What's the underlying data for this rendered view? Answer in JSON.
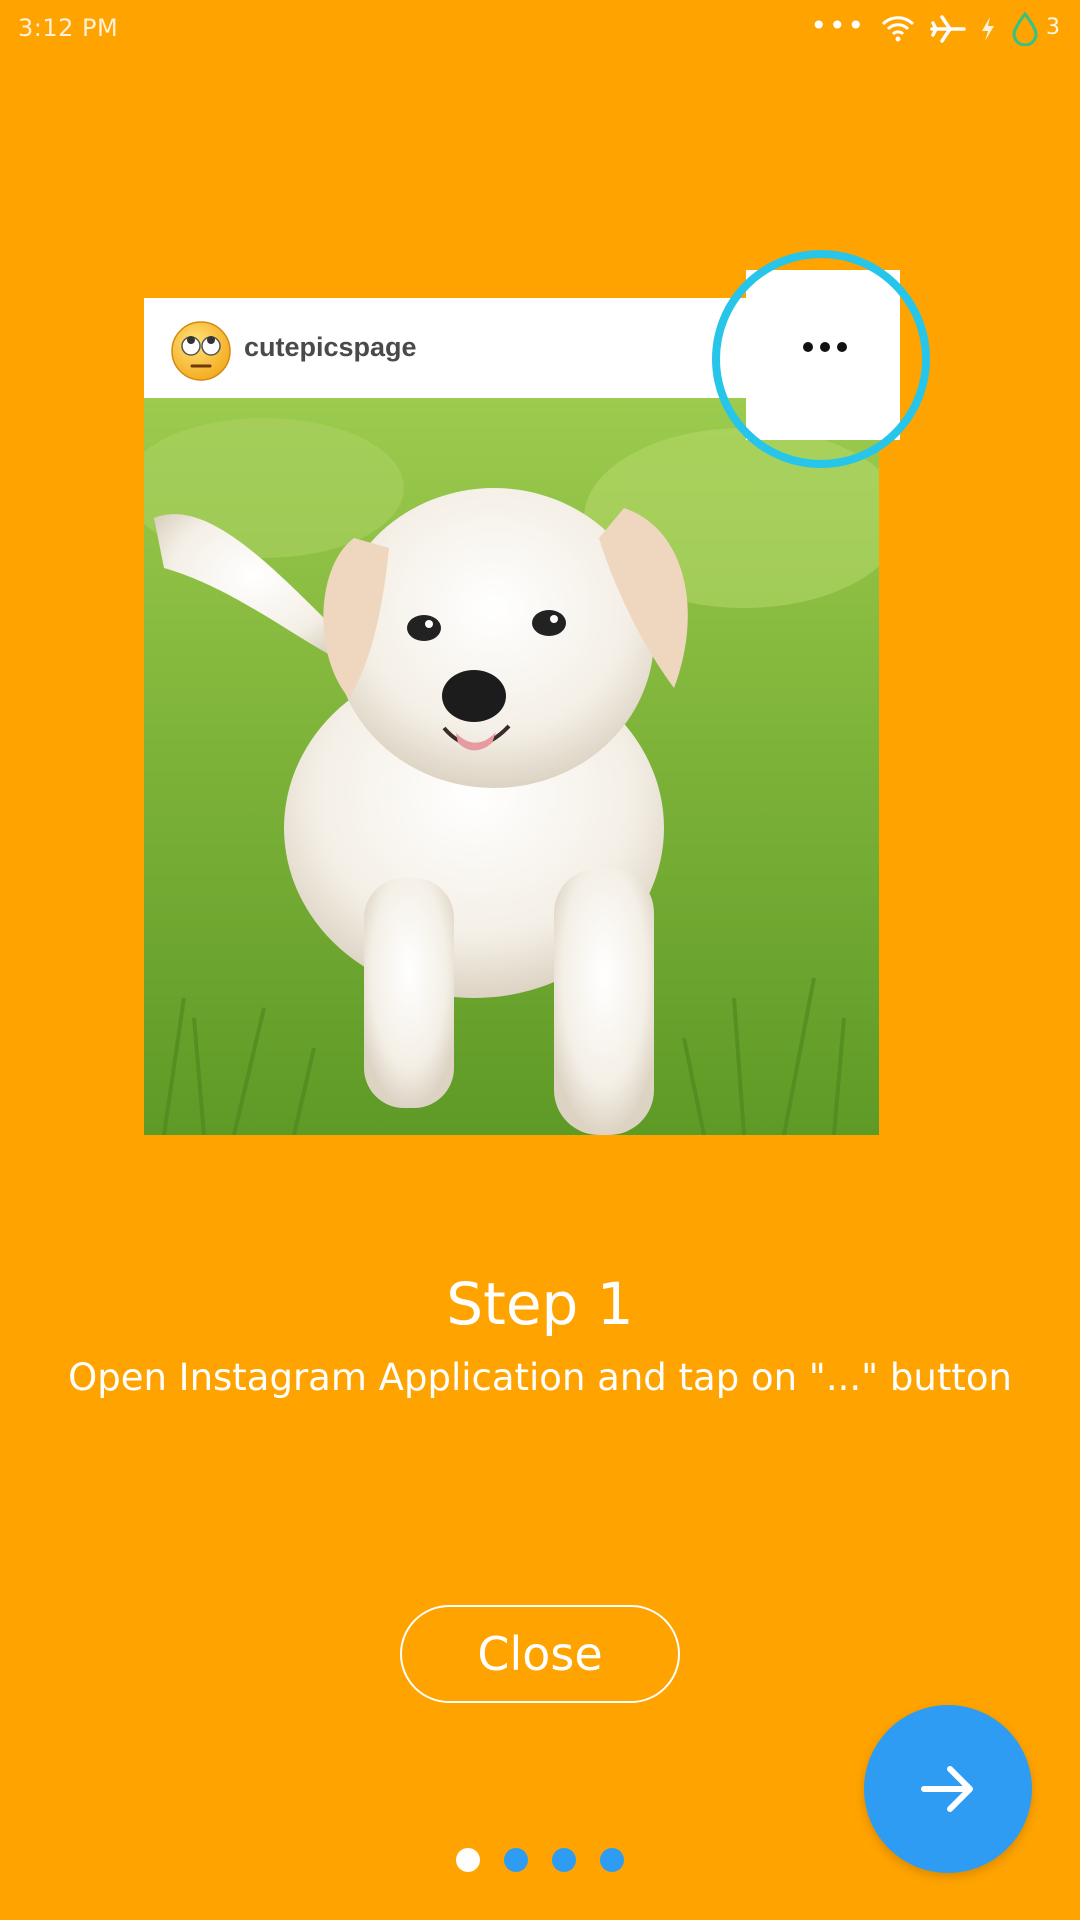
{
  "status_bar": {
    "time": "3:12 PM",
    "icons": [
      "more-dots-icon",
      "wifi-icon",
      "airplane-mode-icon",
      "charging-bolt-icon",
      "battery-drop-icon"
    ],
    "battery_level": "3"
  },
  "tutorial": {
    "post": {
      "username": "cutepicspage",
      "avatar": "eye-roll-emoji",
      "photo": "white puppy running on grass",
      "more_button": "more-options-icon"
    },
    "highlight_color": "#27C5EA",
    "step_title": "Step 1",
    "step_description": "Open Instagram Application and tap on \"...\" button",
    "close_label": "Close",
    "next_button": "arrow-right-icon",
    "pager": {
      "total": 4,
      "current": 1
    }
  },
  "colors": {
    "background": "#FFA300",
    "accent": "#2E9CF2",
    "text": "#FFFFFF"
  }
}
